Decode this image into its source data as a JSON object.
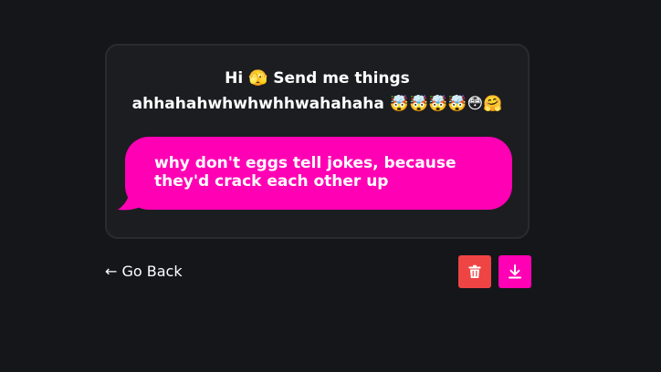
{
  "card": {
    "prompt_line1": "Hi 🫣 Send me things",
    "prompt_line2": "ahhahahwhwhwhhwahahaha 🤯🤯🤯🤯😳🤗"
  },
  "message": {
    "text": "why don't eggs tell jokes, because they'd crack each other up"
  },
  "footer": {
    "back_label": "← Go Back",
    "delete_icon": "trash-icon",
    "download_icon": "download-icon"
  },
  "colors": {
    "background": "#151619",
    "card": "#1c1d21",
    "bubble": "#ff00b4",
    "delete": "#ef4444",
    "download": "#ff00b4"
  }
}
